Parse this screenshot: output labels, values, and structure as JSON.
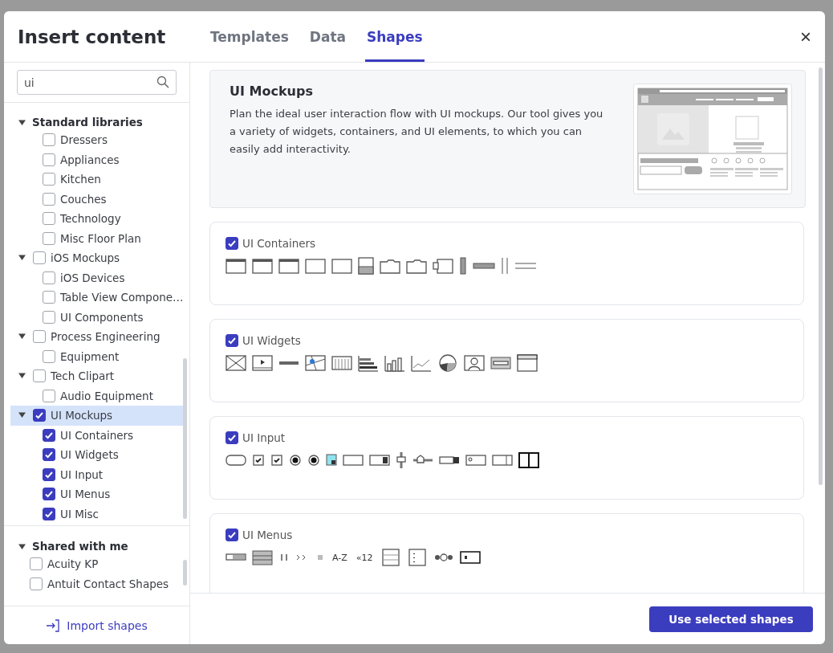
{
  "dialog": {
    "title": "Insert content",
    "close": "×"
  },
  "tabs": [
    {
      "label": "Templates",
      "selected": false
    },
    {
      "label": "Data",
      "selected": false
    },
    {
      "label": "Shapes",
      "selected": true
    }
  ],
  "search": {
    "value": "ui"
  },
  "sidebar": {
    "sections": [
      {
        "label": "Standard libraries",
        "expanded": true,
        "items": [
          {
            "children": [
              {
                "label": "Dressers",
                "checked": false
              },
              {
                "label": "Appliances",
                "checked": false
              },
              {
                "label": "Kitchen",
                "checked": false
              },
              {
                "label": "Couches",
                "checked": false
              },
              {
                "label": "Technology",
                "checked": false
              },
              {
                "label": "Misc Floor Plan",
                "checked": false
              }
            ]
          },
          {
            "label": "iOS Mockups",
            "checked": false,
            "expanded": true,
            "selected": false,
            "children": [
              {
                "label": "iOS Devices",
                "checked": false
              },
              {
                "label": "Table View Compone…",
                "checked": false
              },
              {
                "label": "UI Components",
                "checked": false
              }
            ]
          },
          {
            "label": "Process Engineering",
            "checked": false,
            "expanded": true,
            "selected": false,
            "children": [
              {
                "label": "Equipment",
                "checked": false
              }
            ]
          },
          {
            "label": "Tech Clipart",
            "checked": false,
            "expanded": true,
            "selected": false,
            "children": [
              {
                "label": "Audio Equipment",
                "checked": false
              }
            ]
          },
          {
            "label": "UI Mockups",
            "checked": true,
            "expanded": true,
            "selected": true,
            "children": [
              {
                "label": "UI Containers",
                "checked": true
              },
              {
                "label": "UI Widgets",
                "checked": true
              },
              {
                "label": "UI Input",
                "checked": true
              },
              {
                "label": "UI Menus",
                "checked": true
              },
              {
                "label": "UI Misc",
                "checked": true
              }
            ]
          }
        ]
      },
      {
        "label": "Shared with me",
        "expanded": true,
        "items": [
          {
            "label": "Acuity KP",
            "checked": false,
            "selected": false
          },
          {
            "label": "Antuit Contact Shapes",
            "checked": false,
            "selected": false
          }
        ]
      }
    ],
    "import_link": "Import shapes"
  },
  "hero": {
    "title": "UI Mockups",
    "description": "Plan the ideal user interaction flow with UI mockups. Our tool gives you a variety of widgets, containers, and UI elements, to which you can easily add interactivity."
  },
  "libraries": [
    {
      "name": "UI Containers",
      "checked": true
    },
    {
      "name": "UI Widgets",
      "checked": true
    },
    {
      "name": "UI Input",
      "checked": true
    },
    {
      "name": "UI Menus",
      "checked": true,
      "thumbnail_texts": [
        "A-Z",
        "«12"
      ]
    }
  ],
  "primary_button": "Use selected shapes"
}
